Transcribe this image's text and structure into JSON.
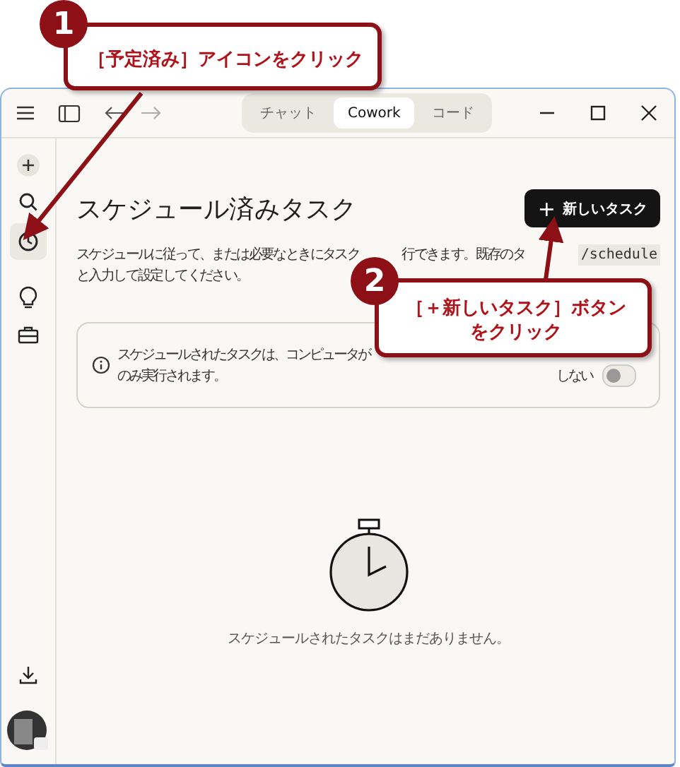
{
  "titlebar": {
    "tabs": [
      {
        "label": "チャット",
        "selected": false
      },
      {
        "label": "Cowork",
        "selected": true
      },
      {
        "label": "コード",
        "selected": false
      }
    ]
  },
  "sidebar": {
    "items": [
      {
        "kind": "new",
        "selected": false
      },
      {
        "kind": "search",
        "selected": false
      },
      {
        "kind": "scheduled",
        "selected": true
      },
      {
        "kind": "ideas",
        "selected": false
      },
      {
        "kind": "tools",
        "selected": false
      }
    ]
  },
  "main": {
    "title": "スケジュール済みタスク",
    "new_button": {
      "icon": "+",
      "label": "新しいタスク"
    },
    "description": {
      "line_1": [
        "スケジュールに従って、または必要なときにタスク",
        "行できます。既存のタ"
      ],
      "command": "/schedule",
      "line_2": "と入力して設定してください。"
    },
    "notice": {
      "line_1": "スケジュールされたタスクは、コンピュータが",
      "line_2": "のみ実行されます。",
      "toggle_label": "しない",
      "toggle_on": false
    },
    "empty_state": "スケジュールされたタスクはまだありません。"
  },
  "annotations": [
    {
      "number": "1",
      "text": "［予定済み］アイコンをクリック"
    },
    {
      "number": "2",
      "text": "［＋新しいタスク］ボタンをクリック"
    }
  ]
}
